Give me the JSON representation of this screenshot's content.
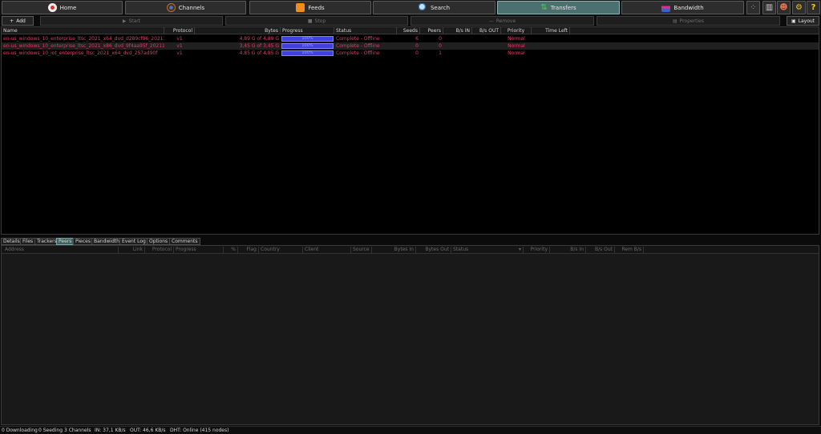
{
  "nav": {
    "home": "Home",
    "channels": "Channels",
    "feeds": "Feeds",
    "search": "Search",
    "transfers": "Transfers",
    "bandwidth": "Bandwidth"
  },
  "toolbar": {
    "add": "Add",
    "start": "Start",
    "stop": "Stop",
    "remove": "Remove",
    "properties": "Properties",
    "layout": "Layout"
  },
  "transfers": {
    "columns": [
      "Name",
      "Protocol",
      "Bytes",
      "Progress",
      "Status",
      "Seeds",
      "Peers",
      "B/s IN",
      "B/s OUT",
      "Priority",
      "Time Left"
    ],
    "rows": [
      {
        "name": "en-us_windows_10_enterprise_ltsc_2021_x64_dvd_d289cf96_202112",
        "protocol": "v1",
        "bytes": "4,89 G of 4,89 G",
        "progress": "100%",
        "progress_value": 1.0,
        "status": "Complete - Offline",
        "seeds": "6",
        "peers": "0",
        "bsin": "",
        "bsout": "",
        "priority": "Normal",
        "timeleft": ""
      },
      {
        "name": "en-us_windows_10_enterprise_ltsc_2021_x86_dvd_9f4aa95f_202112",
        "protocol": "v1",
        "bytes": "3,45 G of 3,45 G",
        "progress": "100%",
        "progress_value": 1.0,
        "status": "Complete - Offline",
        "seeds": "0",
        "peers": "0",
        "bsin": "",
        "bsout": "",
        "priority": "Normal",
        "timeleft": ""
      },
      {
        "name": "en-us_windows_10_iot_enterprise_ltsc_2021_x64_dvd_257ad90f",
        "protocol": "v1",
        "bytes": "4,85 G of 4,85 G",
        "progress": "100%",
        "progress_value": 1.0,
        "status": "Complete - Offline",
        "seeds": "0",
        "peers": "1",
        "bsin": "",
        "bsout": "",
        "priority": "Normal",
        "timeleft": ""
      }
    ]
  },
  "tabs": [
    "Details",
    "Files",
    "Trackers",
    "Peers",
    "Pieces",
    "Bandwidth",
    "Event Log",
    "Options",
    "Comments"
  ],
  "active_tab": "Peers",
  "peers": {
    "columns": [
      "Address",
      "Link",
      "Protocol",
      "Progress",
      "%",
      "Flag",
      "Country",
      "Client",
      "Source",
      "Bytes In",
      "Bytes Out",
      "Status",
      "Priority",
      "B/s In",
      "B/s Out",
      "Rem B/s"
    ]
  },
  "status_bar": {
    "downloading": "0 Downloading",
    "seeding": "0 Seeding",
    "channels": "3 Channels",
    "in": "IN: 37,1 KB/s",
    "out": "OUT: 46,6 KB/s",
    "dht": "DHT: Online (415 nodes)"
  },
  "colors": {
    "accent": "#4c6f6f",
    "row_text": "#e03a66",
    "progress_fill": "#4040e0"
  }
}
